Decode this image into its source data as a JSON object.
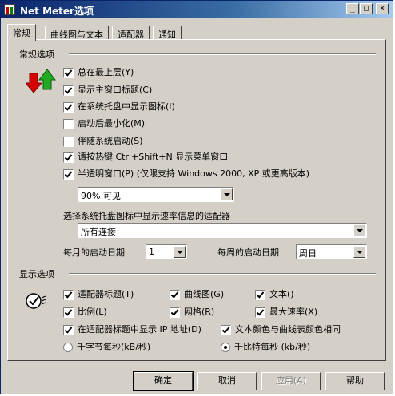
{
  "window": {
    "title": "Net Meter选项",
    "minimize": "_",
    "maximize": "□",
    "close": "×"
  },
  "tabs": [
    "常规",
    "曲线图与文本",
    "适配器",
    "通知"
  ],
  "general": {
    "section_title": "常规选项",
    "options": [
      {
        "label": "总在最上层(Y)",
        "checked": true
      },
      {
        "label": "显示主窗口标题(C)",
        "checked": true
      },
      {
        "label": "在系统托盘中显示图标(I)",
        "checked": true
      },
      {
        "label": "启动后最小化(M)",
        "checked": false
      },
      {
        "label": "伴随系统启动(S)",
        "checked": false
      },
      {
        "label": "请按热键 Ctrl+Shift+N 显示菜单窗口",
        "checked": true
      },
      {
        "label": "半透明窗口(P) (仅限支持 Windows 2000, XP 或更高版本)",
        "checked": true
      }
    ],
    "transparency_value": "90% 可见",
    "adapter_prompt": "选择系统托盘图标中显示速率信息的适配器",
    "adapter_value": "所有连接",
    "month_start_label": "每月的启动日期",
    "month_start_value": "1",
    "week_start_label": "每周的启动日期",
    "week_start_value": "周日"
  },
  "display": {
    "section_title": "显示选项",
    "grid": [
      {
        "label": "适配器标题(T)",
        "checked": true
      },
      {
        "label": "曲线图(G)",
        "checked": true
      },
      {
        "label": "文本()",
        "checked": true
      },
      {
        "label": "比例(L)",
        "checked": true
      },
      {
        "label": "网格(R)",
        "checked": true
      },
      {
        "label": "最大速率(X)",
        "checked": true
      }
    ],
    "show_ip": {
      "label": "在适配器标题中显示 IP 地址(D)",
      "checked": true
    },
    "same_color": {
      "label": "文本颜色与曲线表颜色相同",
      "checked": true
    },
    "unit_bytes": {
      "label": "千字节每秒(kB/秒)",
      "checked": false
    },
    "unit_bits": {
      "label": "千比特每秒 (kb/秒)",
      "checked": true
    }
  },
  "buttons": {
    "ok": "确定",
    "cancel": "取消",
    "apply": "应用(A)",
    "help": "帮助"
  },
  "colors": {
    "title_start": "#0a246a",
    "title_end": "#a6caf0",
    "face": "#d4d0c8"
  }
}
